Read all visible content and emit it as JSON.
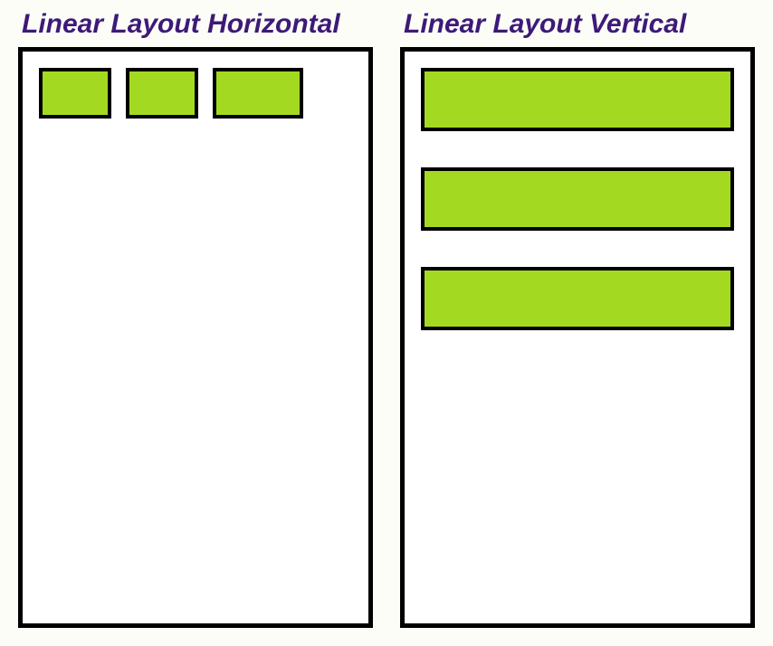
{
  "left": {
    "title": "Linear Layout Horizontal"
  },
  "right": {
    "title": "Linear Layout Vertical"
  }
}
